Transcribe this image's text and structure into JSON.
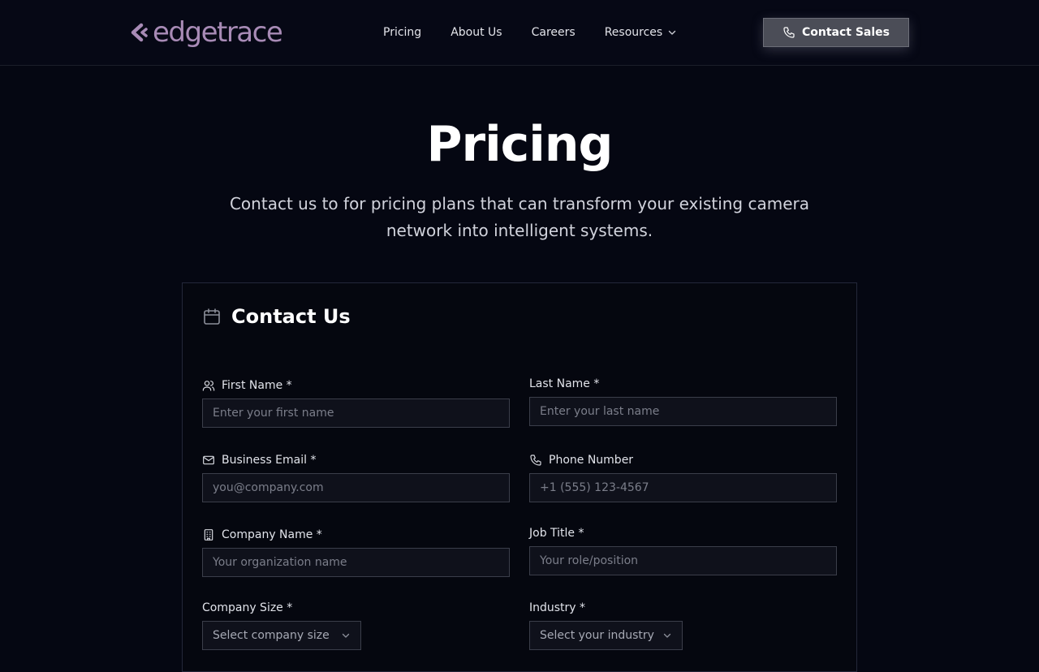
{
  "brand": {
    "name": "edgetrace",
    "color": "#a88bb6"
  },
  "nav": {
    "links": [
      "Pricing",
      "About Us",
      "Careers",
      "Resources"
    ],
    "cta_label": "Contact Sales"
  },
  "hero": {
    "title": "Pricing",
    "subtitle": "Contact us to for pricing plans that can transform your existing camera network into intelligent systems."
  },
  "form": {
    "title": "Contact Us",
    "first_name": {
      "label": "First Name *",
      "placeholder": "Enter your first name",
      "icon": "users-icon"
    },
    "last_name": {
      "label": "Last Name *",
      "placeholder": "Enter your last name"
    },
    "email": {
      "label": "Business Email *",
      "placeholder": "you@company.com",
      "icon": "mail-icon"
    },
    "phone": {
      "label": "Phone Number",
      "placeholder": "+1 (555) 123-4567",
      "icon": "phone-icon"
    },
    "company": {
      "label": "Company Name *",
      "placeholder": "Your organization name",
      "icon": "building-icon"
    },
    "job_title": {
      "label": "Job Title *",
      "placeholder": "Your role/position"
    },
    "company_size": {
      "label": "Company Size *",
      "selected": "Select company size"
    },
    "industry": {
      "label": "Industry *",
      "selected": "Select your industry"
    }
  }
}
